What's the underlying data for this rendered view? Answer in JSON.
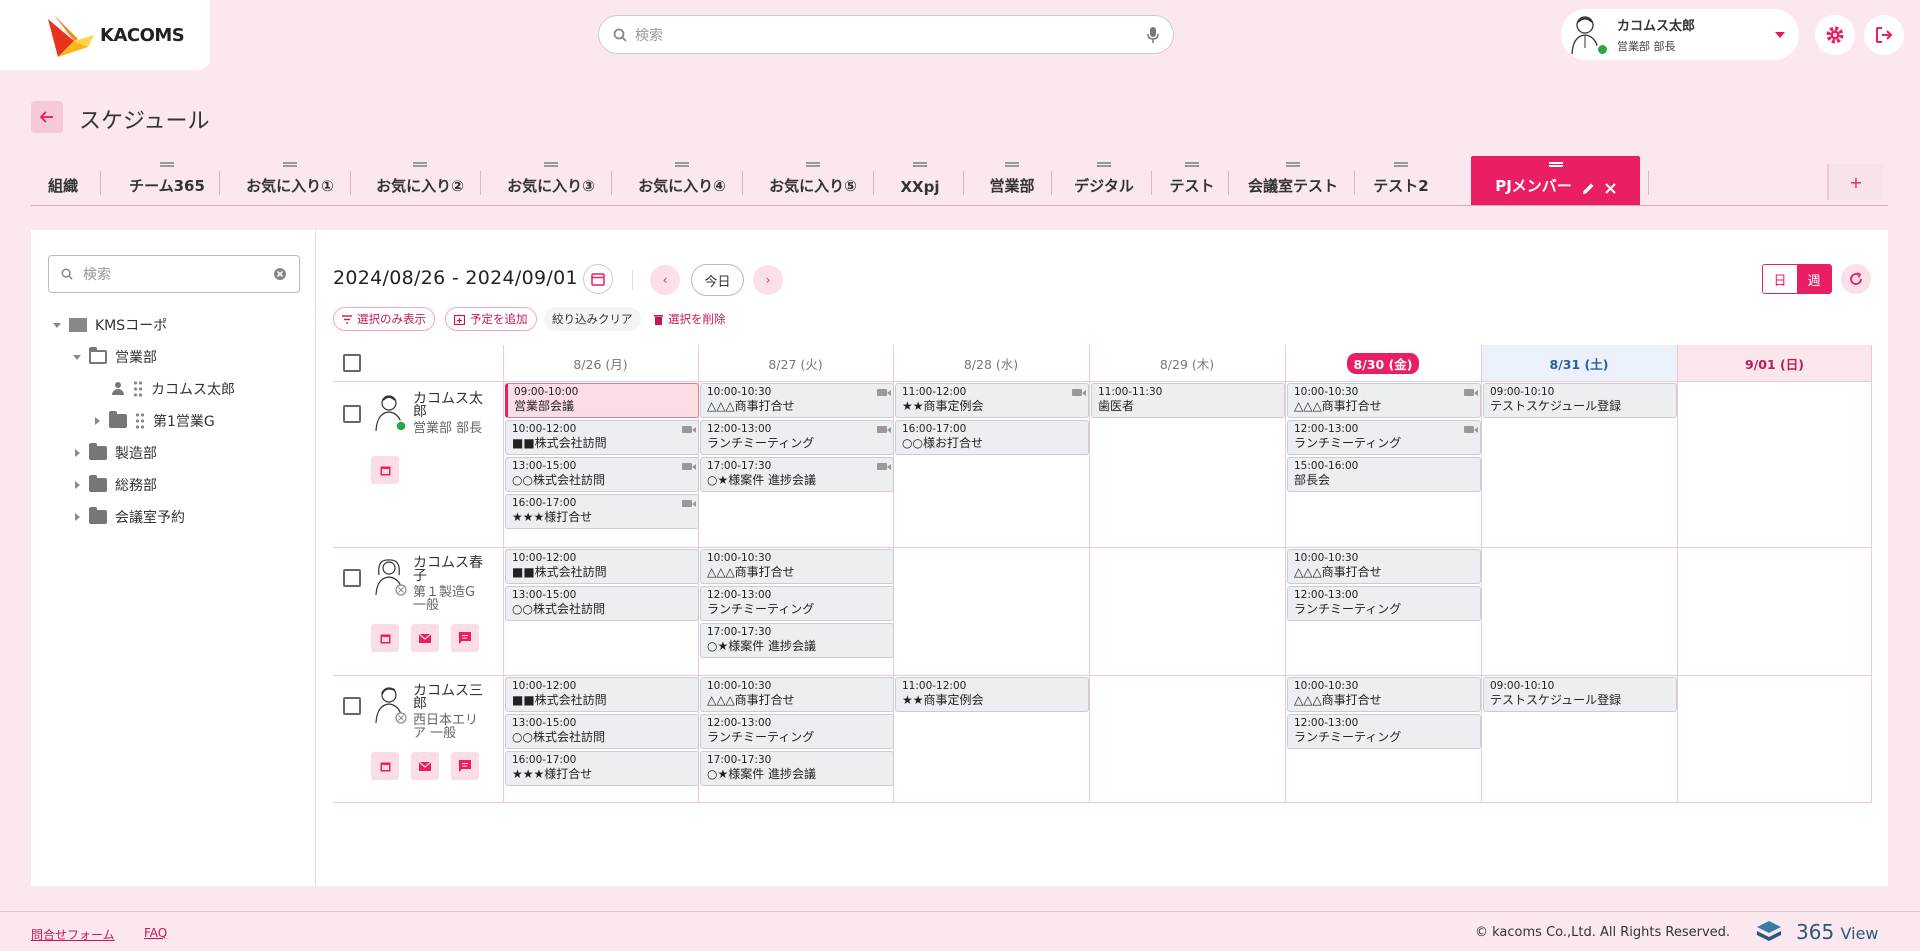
{
  "header": {
    "logo_text": "KACOMS",
    "search_placeholder": "検索",
    "user_name": "カコムス太郎",
    "user_role": "営業部 部長",
    "icons": [
      "search-icon",
      "mic-icon",
      "gear-icon",
      "logout-icon"
    ]
  },
  "page": {
    "title": "スケジュール"
  },
  "tabs": [
    {
      "label": "組織"
    },
    {
      "label": "チーム365"
    },
    {
      "label": "お気に入り①"
    },
    {
      "label": "お気に入り②"
    },
    {
      "label": "お気に入り③"
    },
    {
      "label": "お気に入り④"
    },
    {
      "label": "お気に入り⑤"
    },
    {
      "label": "XXpj"
    },
    {
      "label": "営業部"
    },
    {
      "label": "デジタル"
    },
    {
      "label": "テスト"
    },
    {
      "label": "会議室テスト"
    },
    {
      "label": "テスト2"
    },
    {
      "label": "PJメンバー",
      "active": true
    }
  ],
  "tree": {
    "search_placeholder": "検索",
    "items": [
      {
        "label": "KMSコーポ"
      },
      {
        "label": "営業部"
      },
      {
        "label": "カコムス太郎"
      },
      {
        "label": "第1営業G"
      },
      {
        "label": "製造部"
      },
      {
        "label": "総務部"
      },
      {
        "label": "会議室予約"
      }
    ]
  },
  "schedule": {
    "date_range": "2024/08/26 - 2024/09/01",
    "today_label": "今日",
    "view_day": "日",
    "view_week": "週",
    "actions": {
      "show_selected": "選択のみ表示",
      "add_event": "予定を追加",
      "clear_filter": "絞り込みクリア",
      "delete_selected": "選択を削除"
    },
    "days": [
      "8/26 (月)",
      "8/27 (火)",
      "8/28 (水)",
      "8/29 (木)",
      "8/30 (金)",
      "8/31 (土)",
      "9/01 (日)"
    ],
    "members": [
      {
        "name1": "カコムス太",
        "name2": "郎",
        "role1": "営業部 部長",
        "role2": "",
        "status": "online"
      },
      {
        "name1": "カコムス春",
        "name2": "子",
        "role1": "第１製造G",
        "role2": "一般",
        "status": "offline"
      },
      {
        "name1": "カコムス三",
        "name2": "郎",
        "role1": "西日本エリ",
        "role2": "ア 一般",
        "status": "offline"
      }
    ],
    "events": [
      {
        "m": 0,
        "d": 0,
        "slot": 0,
        "time": "09:00-10:00",
        "title": "営業部会議",
        "highlight": true
      },
      {
        "m": 0,
        "d": 0,
        "slot": 1,
        "time": "10:00-12:00",
        "title": "■■株式会社訪問",
        "video": true
      },
      {
        "m": 0,
        "d": 0,
        "slot": 2,
        "time": "13:00-15:00",
        "title": "○○株式会社訪問",
        "video": true
      },
      {
        "m": 0,
        "d": 0,
        "slot": 3,
        "time": "16:00-17:00",
        "title": "★★★様打合せ",
        "video": true
      },
      {
        "m": 0,
        "d": 1,
        "slot": 0,
        "time": "10:00-10:30",
        "title": "△△△商事打合せ",
        "video": true
      },
      {
        "m": 0,
        "d": 1,
        "slot": 1,
        "time": "12:00-13:00",
        "title": "ランチミーティング",
        "video": true
      },
      {
        "m": 0,
        "d": 1,
        "slot": 2,
        "time": "17:00-17:30",
        "title": "○★様案件 進捗会議",
        "video": true
      },
      {
        "m": 0,
        "d": 2,
        "slot": 0,
        "time": "11:00-12:00",
        "title": "★★商事定例会",
        "video": true
      },
      {
        "m": 0,
        "d": 2,
        "slot": 1,
        "time": "16:00-17:00",
        "title": "○○様お打合せ"
      },
      {
        "m": 0,
        "d": 3,
        "slot": 0,
        "time": "11:00-11:30",
        "title": "歯医者"
      },
      {
        "m": 0,
        "d": 4,
        "slot": 0,
        "time": "10:00-10:30",
        "title": "△△△商事打合せ",
        "video": true
      },
      {
        "m": 0,
        "d": 4,
        "slot": 1,
        "time": "12:00-13:00",
        "title": "ランチミーティング",
        "video": true
      },
      {
        "m": 0,
        "d": 4,
        "slot": 2,
        "time": "15:00-16:00",
        "title": "部長会"
      },
      {
        "m": 0,
        "d": 5,
        "slot": 0,
        "time": "09:00-10:10",
        "title": "テストスケジュール登録"
      },
      {
        "m": 1,
        "d": 0,
        "slot": 0,
        "time": "10:00-12:00",
        "title": "■■株式会社訪問"
      },
      {
        "m": 1,
        "d": 0,
        "slot": 1,
        "time": "13:00-15:00",
        "title": "○○株式会社訪問"
      },
      {
        "m": 1,
        "d": 1,
        "slot": 0,
        "time": "10:00-10:30",
        "title": "△△△商事打合せ"
      },
      {
        "m": 1,
        "d": 1,
        "slot": 1,
        "time": "12:00-13:00",
        "title": "ランチミーティング"
      },
      {
        "m": 1,
        "d": 1,
        "slot": 2,
        "time": "17:00-17:30",
        "title": "○★様案件 進捗会議"
      },
      {
        "m": 1,
        "d": 4,
        "slot": 0,
        "time": "10:00-10:30",
        "title": "△△△商事打合せ"
      },
      {
        "m": 1,
        "d": 4,
        "slot": 1,
        "time": "12:00-13:00",
        "title": "ランチミーティング"
      },
      {
        "m": 2,
        "d": 0,
        "slot": 0,
        "time": "10:00-12:00",
        "title": "■■株式会社訪問"
      },
      {
        "m": 2,
        "d": 0,
        "slot": 1,
        "time": "13:00-15:00",
        "title": "○○株式会社訪問"
      },
      {
        "m": 2,
        "d": 0,
        "slot": 2,
        "time": "16:00-17:00",
        "title": "★★★様打合せ"
      },
      {
        "m": 2,
        "d": 1,
        "slot": 0,
        "time": "10:00-10:30",
        "title": "△△△商事打合せ"
      },
      {
        "m": 2,
        "d": 1,
        "slot": 1,
        "time": "12:00-13:00",
        "title": "ランチミーティング"
      },
      {
        "m": 2,
        "d": 1,
        "slot": 2,
        "time": "17:00-17:30",
        "title": "○★様案件 進捗会議"
      },
      {
        "m": 2,
        "d": 2,
        "slot": 0,
        "time": "11:00-12:00",
        "title": "★★商事定例会"
      },
      {
        "m": 2,
        "d": 4,
        "slot": 0,
        "time": "10:00-10:30",
        "title": "△△△商事打合せ"
      },
      {
        "m": 2,
        "d": 4,
        "slot": 1,
        "time": "12:00-13:00",
        "title": "ランチミーティング"
      },
      {
        "m": 2,
        "d": 5,
        "slot": 0,
        "time": "09:00-10:10",
        "title": "テストスケジュール登録"
      }
    ]
  },
  "footer": {
    "contact": "問合せフォーム",
    "faq": "FAQ",
    "copyright": "© kacoms Co.,Ltd. All Rights Reserved.",
    "brand_num": "365",
    "brand_word": "View"
  },
  "colors": {
    "accent": "#e91e63",
    "background": "#fbe8ee",
    "online": "#27a844"
  }
}
